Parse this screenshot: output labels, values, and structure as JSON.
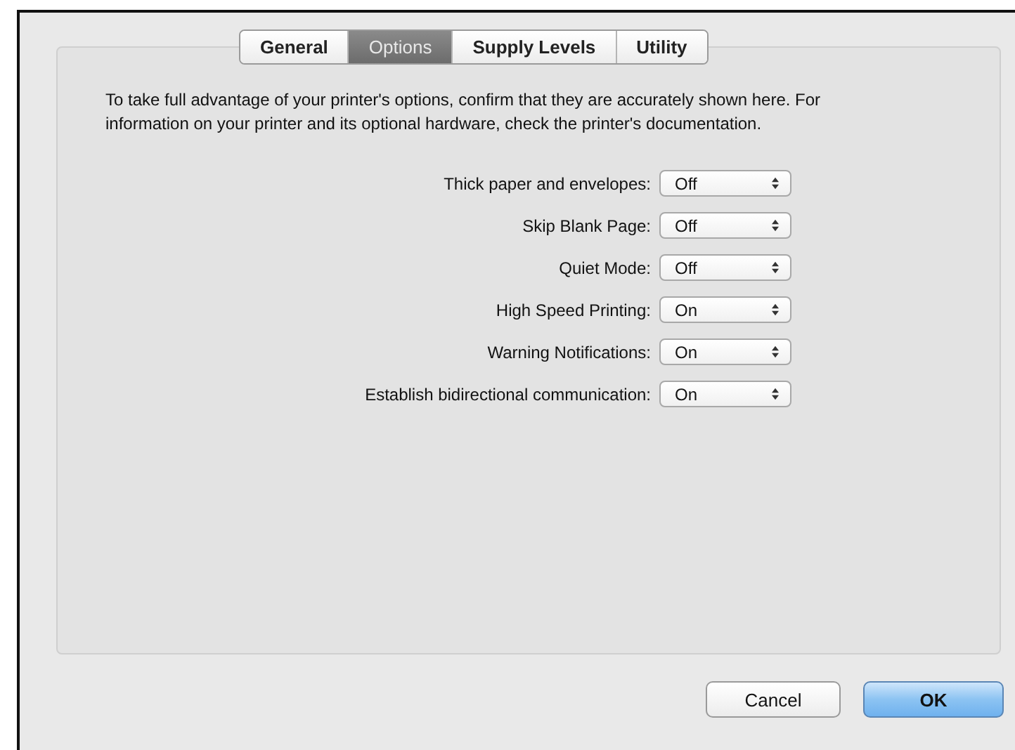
{
  "tabs": [
    {
      "label": "General",
      "selected": false
    },
    {
      "label": "Options",
      "selected": true
    },
    {
      "label": "Supply Levels",
      "selected": false
    },
    {
      "label": "Utility",
      "selected": false
    }
  ],
  "description": "To take full advantage of your printer's options, confirm that they are accurately shown here. For information on your printer and its optional hardware, check the printer's documentation.",
  "options": [
    {
      "label": "Thick paper and envelopes:",
      "value": "Off"
    },
    {
      "label": "Skip Blank Page:",
      "value": "Off"
    },
    {
      "label": "Quiet Mode:",
      "value": "Off"
    },
    {
      "label": "High Speed Printing:",
      "value": "On"
    },
    {
      "label": "Warning Notifications:",
      "value": "On"
    },
    {
      "label": "Establish bidirectional communication:",
      "value": "On"
    }
  ],
  "buttons": [
    {
      "label": "Cancel",
      "default": false
    },
    {
      "label": "OK",
      "default": true
    }
  ]
}
